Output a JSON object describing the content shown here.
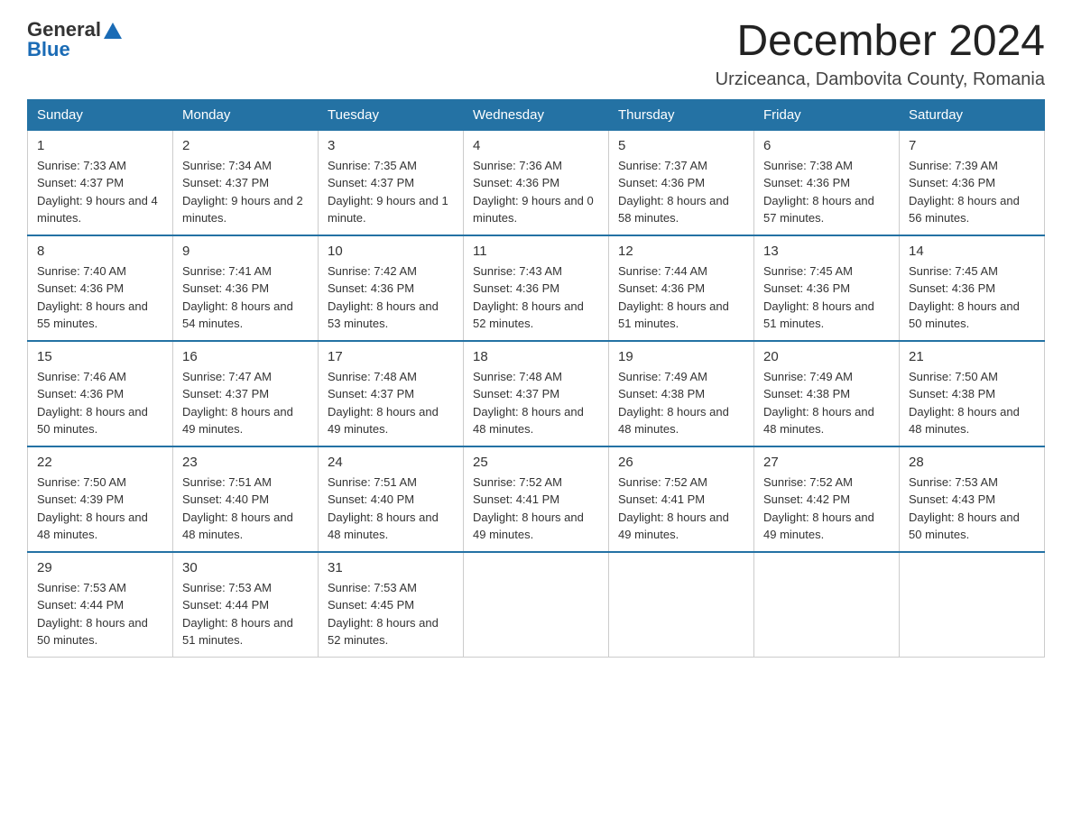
{
  "logo": {
    "general": "General",
    "blue": "Blue"
  },
  "title": {
    "month_year": "December 2024",
    "location": "Urziceanca, Dambovita County, Romania"
  },
  "weekdays": [
    "Sunday",
    "Monday",
    "Tuesday",
    "Wednesday",
    "Thursday",
    "Friday",
    "Saturday"
  ],
  "weeks": [
    [
      {
        "day": "1",
        "sunrise": "7:33 AM",
        "sunset": "4:37 PM",
        "daylight": "9 hours and 4 minutes."
      },
      {
        "day": "2",
        "sunrise": "7:34 AM",
        "sunset": "4:37 PM",
        "daylight": "9 hours and 2 minutes."
      },
      {
        "day": "3",
        "sunrise": "7:35 AM",
        "sunset": "4:37 PM",
        "daylight": "9 hours and 1 minute."
      },
      {
        "day": "4",
        "sunrise": "7:36 AM",
        "sunset": "4:36 PM",
        "daylight": "9 hours and 0 minutes."
      },
      {
        "day": "5",
        "sunrise": "7:37 AM",
        "sunset": "4:36 PM",
        "daylight": "8 hours and 58 minutes."
      },
      {
        "day": "6",
        "sunrise": "7:38 AM",
        "sunset": "4:36 PM",
        "daylight": "8 hours and 57 minutes."
      },
      {
        "day": "7",
        "sunrise": "7:39 AM",
        "sunset": "4:36 PM",
        "daylight": "8 hours and 56 minutes."
      }
    ],
    [
      {
        "day": "8",
        "sunrise": "7:40 AM",
        "sunset": "4:36 PM",
        "daylight": "8 hours and 55 minutes."
      },
      {
        "day": "9",
        "sunrise": "7:41 AM",
        "sunset": "4:36 PM",
        "daylight": "8 hours and 54 minutes."
      },
      {
        "day": "10",
        "sunrise": "7:42 AM",
        "sunset": "4:36 PM",
        "daylight": "8 hours and 53 minutes."
      },
      {
        "day": "11",
        "sunrise": "7:43 AM",
        "sunset": "4:36 PM",
        "daylight": "8 hours and 52 minutes."
      },
      {
        "day": "12",
        "sunrise": "7:44 AM",
        "sunset": "4:36 PM",
        "daylight": "8 hours and 51 minutes."
      },
      {
        "day": "13",
        "sunrise": "7:45 AM",
        "sunset": "4:36 PM",
        "daylight": "8 hours and 51 minutes."
      },
      {
        "day": "14",
        "sunrise": "7:45 AM",
        "sunset": "4:36 PM",
        "daylight": "8 hours and 50 minutes."
      }
    ],
    [
      {
        "day": "15",
        "sunrise": "7:46 AM",
        "sunset": "4:36 PM",
        "daylight": "8 hours and 50 minutes."
      },
      {
        "day": "16",
        "sunrise": "7:47 AM",
        "sunset": "4:37 PM",
        "daylight": "8 hours and 49 minutes."
      },
      {
        "day": "17",
        "sunrise": "7:48 AM",
        "sunset": "4:37 PM",
        "daylight": "8 hours and 49 minutes."
      },
      {
        "day": "18",
        "sunrise": "7:48 AM",
        "sunset": "4:37 PM",
        "daylight": "8 hours and 48 minutes."
      },
      {
        "day": "19",
        "sunrise": "7:49 AM",
        "sunset": "4:38 PM",
        "daylight": "8 hours and 48 minutes."
      },
      {
        "day": "20",
        "sunrise": "7:49 AM",
        "sunset": "4:38 PM",
        "daylight": "8 hours and 48 minutes."
      },
      {
        "day": "21",
        "sunrise": "7:50 AM",
        "sunset": "4:38 PM",
        "daylight": "8 hours and 48 minutes."
      }
    ],
    [
      {
        "day": "22",
        "sunrise": "7:50 AM",
        "sunset": "4:39 PM",
        "daylight": "8 hours and 48 minutes."
      },
      {
        "day": "23",
        "sunrise": "7:51 AM",
        "sunset": "4:40 PM",
        "daylight": "8 hours and 48 minutes."
      },
      {
        "day": "24",
        "sunrise": "7:51 AM",
        "sunset": "4:40 PM",
        "daylight": "8 hours and 48 minutes."
      },
      {
        "day": "25",
        "sunrise": "7:52 AM",
        "sunset": "4:41 PM",
        "daylight": "8 hours and 49 minutes."
      },
      {
        "day": "26",
        "sunrise": "7:52 AM",
        "sunset": "4:41 PM",
        "daylight": "8 hours and 49 minutes."
      },
      {
        "day": "27",
        "sunrise": "7:52 AM",
        "sunset": "4:42 PM",
        "daylight": "8 hours and 49 minutes."
      },
      {
        "day": "28",
        "sunrise": "7:53 AM",
        "sunset": "4:43 PM",
        "daylight": "8 hours and 50 minutes."
      }
    ],
    [
      {
        "day": "29",
        "sunrise": "7:53 AM",
        "sunset": "4:44 PM",
        "daylight": "8 hours and 50 minutes."
      },
      {
        "day": "30",
        "sunrise": "7:53 AM",
        "sunset": "4:44 PM",
        "daylight": "8 hours and 51 minutes."
      },
      {
        "day": "31",
        "sunrise": "7:53 AM",
        "sunset": "4:45 PM",
        "daylight": "8 hours and 52 minutes."
      },
      null,
      null,
      null,
      null
    ]
  ],
  "labels": {
    "sunrise": "Sunrise:",
    "sunset": "Sunset:",
    "daylight": "Daylight:"
  }
}
